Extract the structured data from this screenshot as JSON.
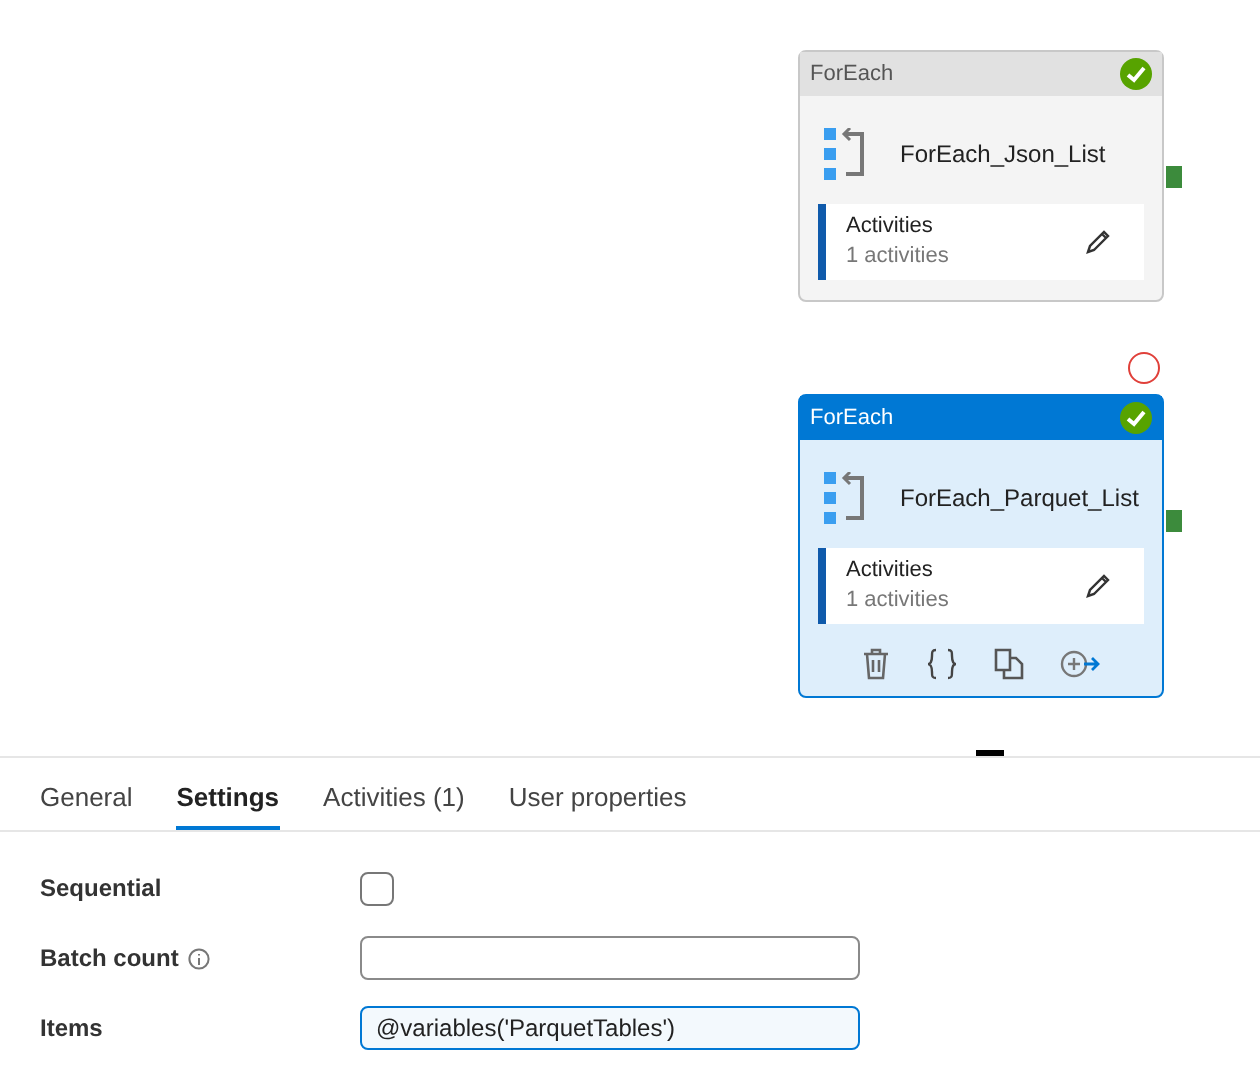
{
  "canvas": {
    "nodes": [
      {
        "type": "ForEach",
        "name": "ForEach_Json_List",
        "activities_label": "Activities",
        "activities_count": "1 activities",
        "selected": false,
        "succeeded": true
      },
      {
        "type": "ForEach",
        "name": "ForEach_Parquet_List",
        "activities_label": "Activities",
        "activities_count": "1 activities",
        "selected": true,
        "succeeded": true
      }
    ]
  },
  "tabs": [
    {
      "label": "General",
      "selected": false
    },
    {
      "label": "Settings",
      "selected": true
    },
    {
      "label": "Activities (1)",
      "selected": false
    },
    {
      "label": "User properties",
      "selected": false
    }
  ],
  "settings": [
    {
      "kind": "checkbox",
      "label": "Sequential",
      "checked": false
    },
    {
      "kind": "text",
      "label": "Batch count",
      "info": true
    },
    {
      "kind": "text",
      "label": "Items",
      "value": "@variables('ParquetTables')",
      "focused": true
    }
  ]
}
